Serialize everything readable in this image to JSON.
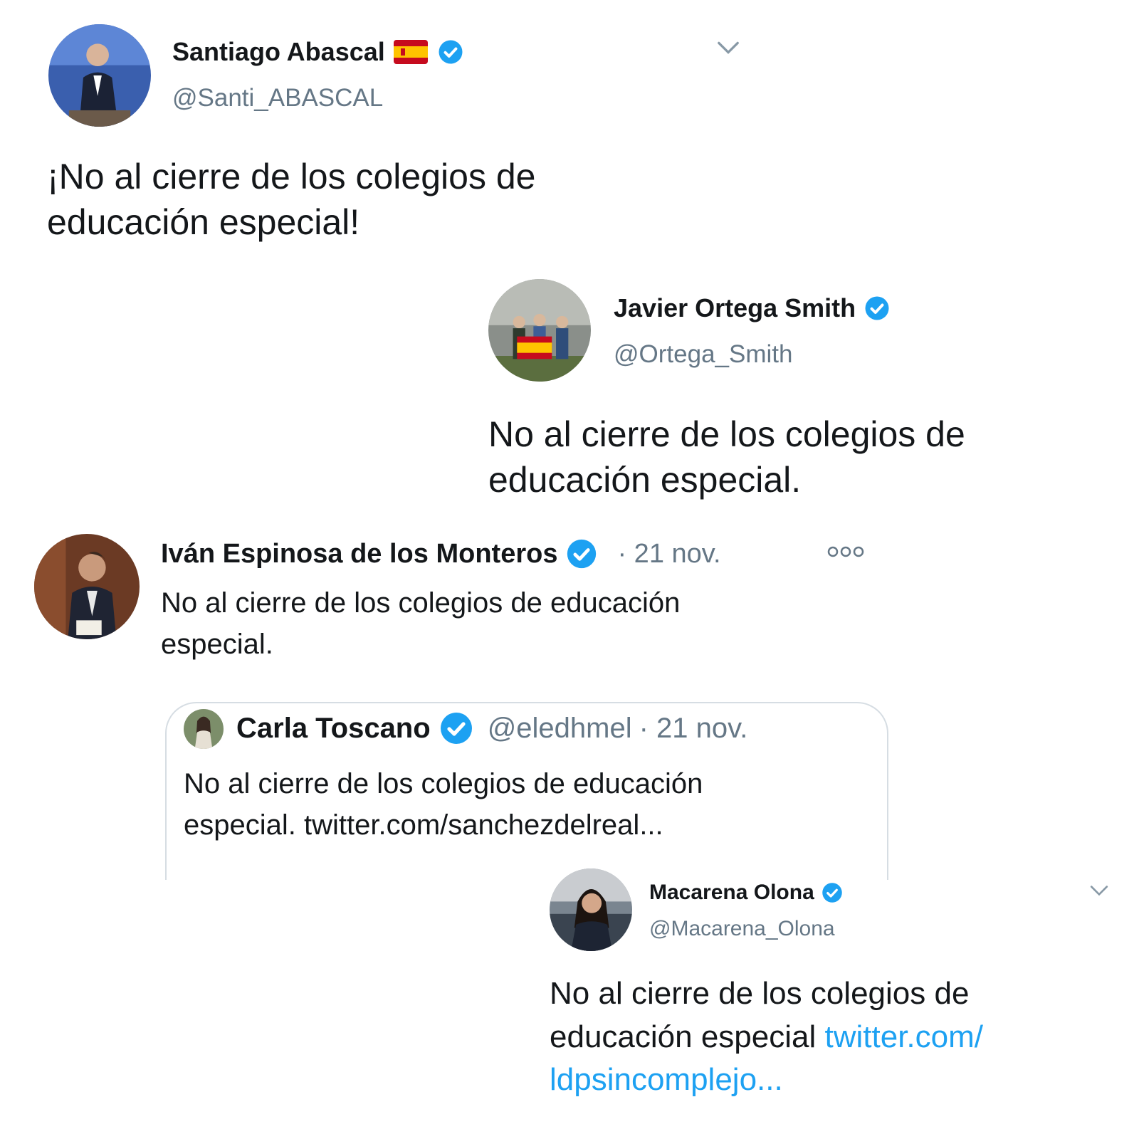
{
  "tweets": [
    {
      "name": "Santiago Abascal",
      "flag": "spain-flag-emoji",
      "handle": "@Santi_ABASCAL",
      "text": "¡No al cierre de los colegios de educación especial!"
    },
    {
      "name": "Javier Ortega Smith",
      "handle": "@Ortega_Smith",
      "text": "No al cierre de los colegios de educación especial."
    },
    {
      "name": "Iván Espinosa de los Monteros",
      "date": "· 21 nov.",
      "more": "ooo",
      "text": "No al cierre de los colegios de educación especial.",
      "quoted": {
        "name": "Carla Toscano",
        "handle": "@eledhmel",
        "date": "· 21 nov.",
        "text": "No al cierre de los colegios de educación especial. twitter.com/sanchezdelreal..."
      }
    },
    {
      "name": "Macarena Olona",
      "handle": "@Macarena_Olona",
      "text": "No al cierre de los colegios de educación especial",
      "link": "twitter.com/ ldpsincomplejo..."
    }
  ],
  "colors": {
    "verified": "#1da1f2",
    "link": "#1da1f2",
    "handle": "#657786"
  }
}
